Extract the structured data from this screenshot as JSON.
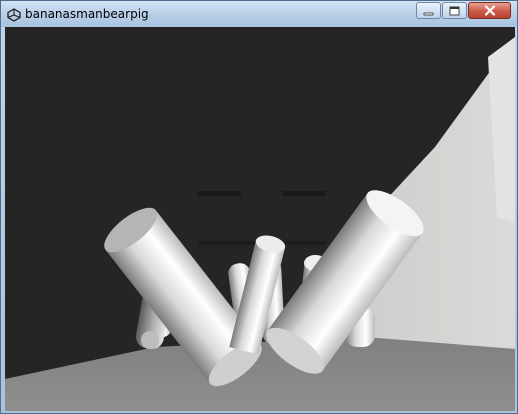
{
  "window": {
    "title": "bananasmanbearpig",
    "app_icon": "unity-icon",
    "controls": {
      "minimize_icon": "minimize-icon",
      "maximize_icon": "maximize-icon",
      "close_icon": "close-icon"
    }
  },
  "viewport": {
    "scene": "3d-render",
    "colors": {
      "back_wall": "#252525",
      "right_wall": "#d6d7d4",
      "floor": "#8c8c8c",
      "objects": "#dcdcdc"
    }
  }
}
